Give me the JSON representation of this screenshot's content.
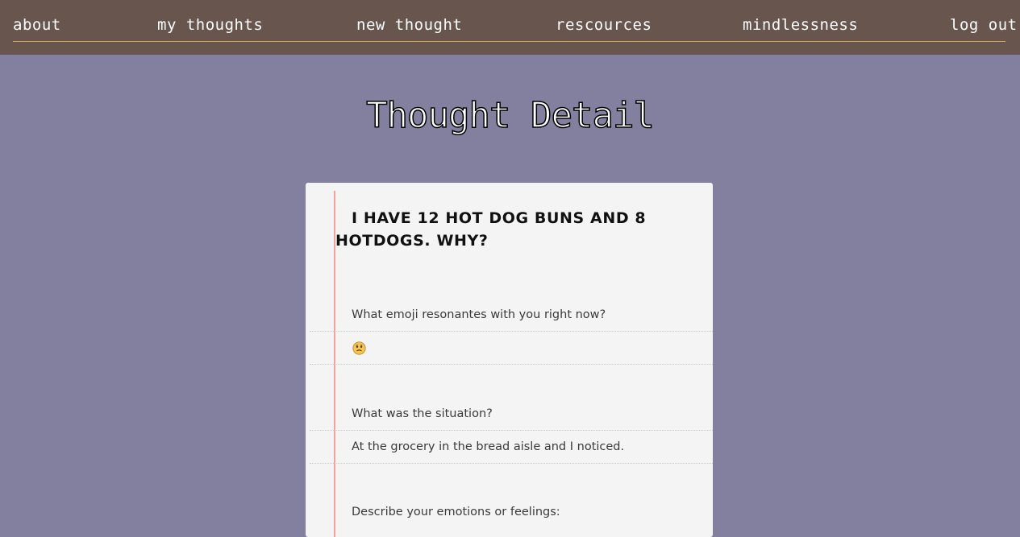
{
  "nav": {
    "about": "about",
    "my_thoughts": "my thoughts",
    "new_thought": "new thought",
    "resources": "rescources",
    "mindlessness": "mindlessness",
    "log_out": "log out"
  },
  "page": {
    "title": "Thought Detail"
  },
  "thought": {
    "title": "I have 12 hot dog buns and 8 hotdogs. Why?",
    "questions": [
      {
        "prompt": "What emoji resonantes with you right now?",
        "answer_icon": "worried-face-emoji"
      },
      {
        "prompt": "What was the situation?",
        "answer": "At the grocery in the bread aisle and I noticed."
      },
      {
        "prompt": "Describe your emotions or feelings:"
      }
    ]
  },
  "colors": {
    "background": "#837f9f",
    "topbar": "#68554e",
    "nav_underline": "#d4a256",
    "card": "#f4f4f4",
    "margin_line": "#f2a49a"
  }
}
